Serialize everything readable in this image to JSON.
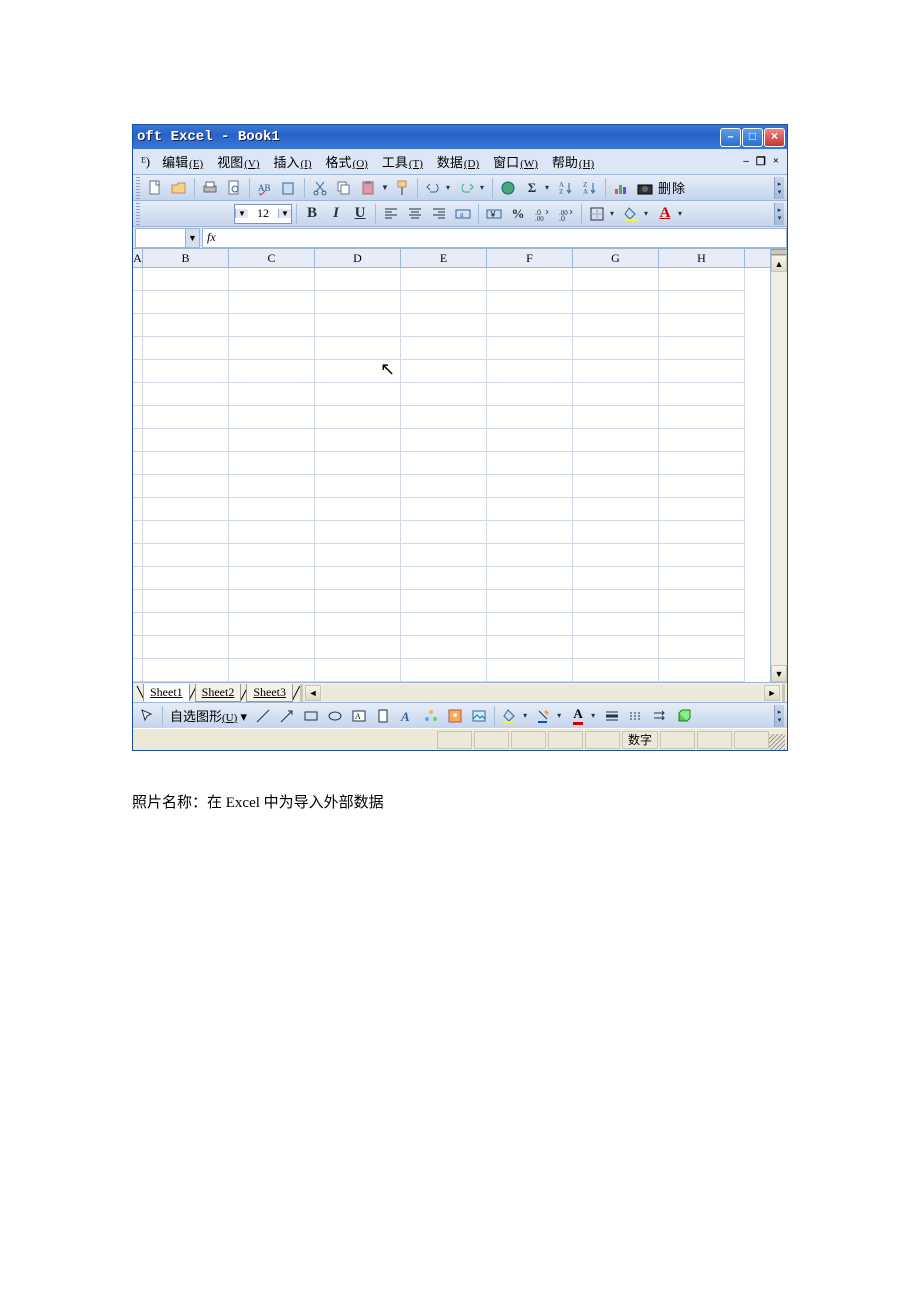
{
  "titlebar": {
    "text": "oft Excel - Book1"
  },
  "winctrls": {
    "min": "–",
    "max": "□",
    "close": "×"
  },
  "docctrls": {
    "min": "–",
    "restore": "❐",
    "close": "×"
  },
  "menu": {
    "partial": "ᴱ)",
    "items": [
      {
        "label": "编辑",
        "mn": "(E)"
      },
      {
        "label": "视图",
        "mn": "(V)"
      },
      {
        "label": "插入",
        "mn": "(I)"
      },
      {
        "label": "格式",
        "mn": "(O)"
      },
      {
        "label": "工具",
        "mn": "(T)"
      },
      {
        "label": "数据",
        "mn": "(D)"
      },
      {
        "label": "窗口",
        "mn": "(W)"
      },
      {
        "label": "帮助",
        "mn": "(H)"
      }
    ]
  },
  "toolbar1": {
    "delete_label": "删除"
  },
  "toolbar2": {
    "fontsize": "12",
    "bold": "B",
    "italic": "I",
    "underline": "U",
    "percent": "%",
    "a_under": "A"
  },
  "namebox": {
    "value": ""
  },
  "formulabar": {
    "fx": "fx",
    "value": ""
  },
  "columns": [
    "A",
    "B",
    "C",
    "D",
    "E",
    "F",
    "G",
    "H"
  ],
  "rows": 18,
  "sheets": {
    "tabs": [
      "Sheet1",
      "Sheet2",
      "Sheet3"
    ],
    "active": 0
  },
  "draw_toolbar": {
    "autoshape_label": "自选图形",
    "autoshape_mn": "(U)",
    "a": "A"
  },
  "statusbar": {
    "num": "数字"
  },
  "caption": "照片名称：在 Excel 中为导入外部数据"
}
